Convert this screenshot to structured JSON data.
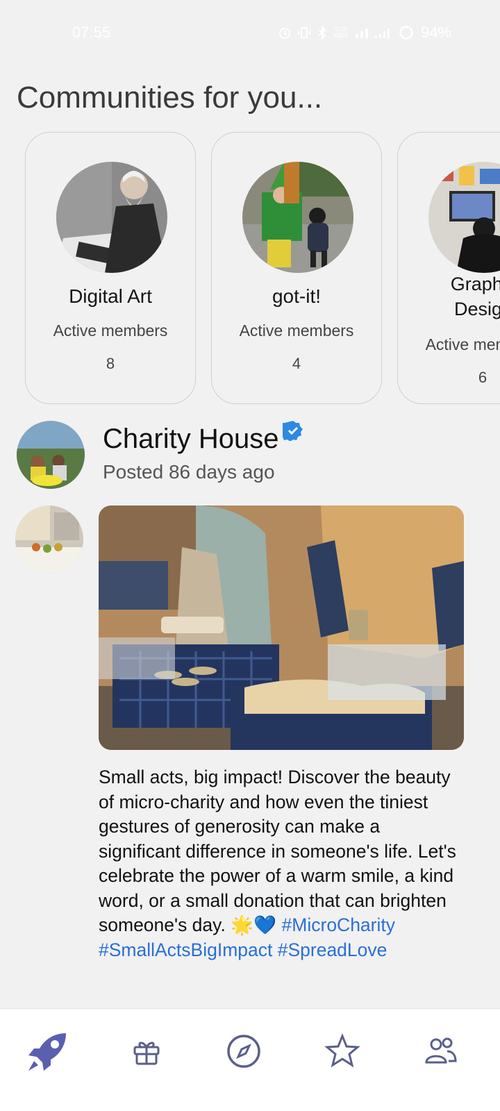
{
  "status_bar": {
    "time": "07:55",
    "battery": "94%",
    "icons": [
      "alarm-icon",
      "vibrate-icon",
      "bluetooth-icon",
      "data-speed-icon",
      "volte-icon",
      "signal-icon",
      "battery-icon"
    ],
    "data_speed": "0.00 KB/S"
  },
  "communities": {
    "title": "Communities for you...",
    "items": [
      {
        "name": "Digital Art",
        "label": "Active members",
        "count": "8"
      },
      {
        "name": "got-it!",
        "label": "Active members",
        "count": "4"
      },
      {
        "name": "Graphic Design",
        "label": "Active members",
        "count": "6"
      }
    ]
  },
  "post": {
    "author": "Charity House",
    "posted": "Posted 86 days ago",
    "text": "Small acts, big impact! Discover the beauty of micro-charity and how even the tiniest gestures of generosity can make a significant difference in someone's life. Let's celebrate the power of a warm smile, a kind word, or a small donation that can brighten someone's day. 🌟💙",
    "tags": "#MicroCharity #SmallActsBigImpact #SpreadLove"
  },
  "nav": {
    "items": [
      "rocket-icon",
      "gift-icon",
      "compass-icon",
      "star-icon",
      "people-icon"
    ],
    "active_color": "#5b5fb0",
    "inactive_color": "#5a5f8a"
  }
}
